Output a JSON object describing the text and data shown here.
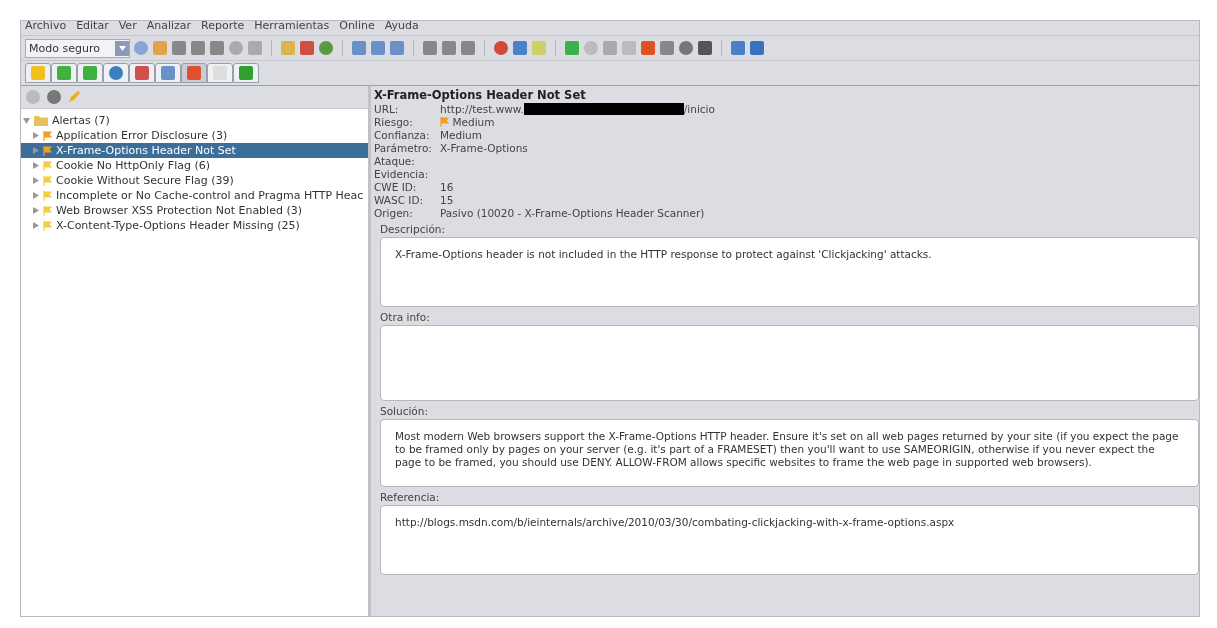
{
  "menu": [
    "Archivo",
    "Editar",
    "Ver",
    "Analizar",
    "Reporte",
    "Herramientas",
    "Online",
    "Ayuda"
  ],
  "mode_select": {
    "value": "Modo seguro"
  },
  "tree": {
    "label": "Alertas (7)",
    "expanded": true,
    "children": [
      {
        "label": "Application Error Disclosure (3)",
        "selected": false,
        "color": "#f0a020"
      },
      {
        "label": "X-Frame-Options Header Not Set",
        "selected": true,
        "color": "#f0a020"
      },
      {
        "label": "Cookie No HttpOnly Flag (6)",
        "selected": false,
        "color": "#f2cf40"
      },
      {
        "label": "Cookie Without Secure Flag (39)",
        "selected": false,
        "color": "#f2cf40"
      },
      {
        "label": "Incomplete or No Cache-control and Pragma HTTP Heac",
        "selected": false,
        "color": "#f2cf40"
      },
      {
        "label": "Web Browser XSS Protection Not Enabled (3)",
        "selected": false,
        "color": "#f2cf40"
      },
      {
        "label": "X-Content-Type-Options Header Missing (25)",
        "selected": false,
        "color": "#f2cf40"
      }
    ]
  },
  "detail": {
    "title": "X-Frame-Options Header Not Set",
    "fields": [
      {
        "kind": "url",
        "label": "URL:",
        "value": "http://test.www.",
        "suffix": "/inicio"
      },
      {
        "kind": "risk",
        "label": "Riesgo:",
        "value": "Medium",
        "color": "#f0a020"
      },
      {
        "kind": "text",
        "label": "Confianza:",
        "value": "Medium"
      },
      {
        "kind": "text",
        "label": "Parámetro:",
        "value": "X-Frame-Options"
      },
      {
        "kind": "text",
        "label": "Ataque:"
      },
      {
        "kind": "text",
        "label": "Evidencia:"
      },
      {
        "kind": "text",
        "label": "CWE ID:",
        "value": "16"
      },
      {
        "kind": "text",
        "label": "WASC ID:",
        "value": "15"
      },
      {
        "kind": "text",
        "label": "Origen:",
        "value": "Pasivo (10020 - X-Frame-Options Header Scanner)"
      }
    ],
    "sections": [
      {
        "label": "Descripción:",
        "text": "X-Frame-Options header is not included in the HTTP response to protect against 'Clickjacking' attacks."
      },
      {
        "label": "Otra info:"
      },
      {
        "label": "Solución:",
        "text": "Most modern Web browsers support the X-Frame-Options HTTP header. Ensure it's set on all web pages returned by your site (if you expect the page to be framed only by pages on your server (e.g. it's part of a FRAMESET) then you'll want to use SAMEORIGIN, otherwise if you never expect the page to be framed, you should use DENY. ALLOW-FROM allows specific websites to frame the web page in supported web browsers)."
      },
      {
        "label": "Referencia:",
        "text": "http://blogs.msdn.com/b/ieinternals/archive/2010/03/30/combating-clickjacking-with-x-frame-options.aspx"
      }
    ]
  }
}
